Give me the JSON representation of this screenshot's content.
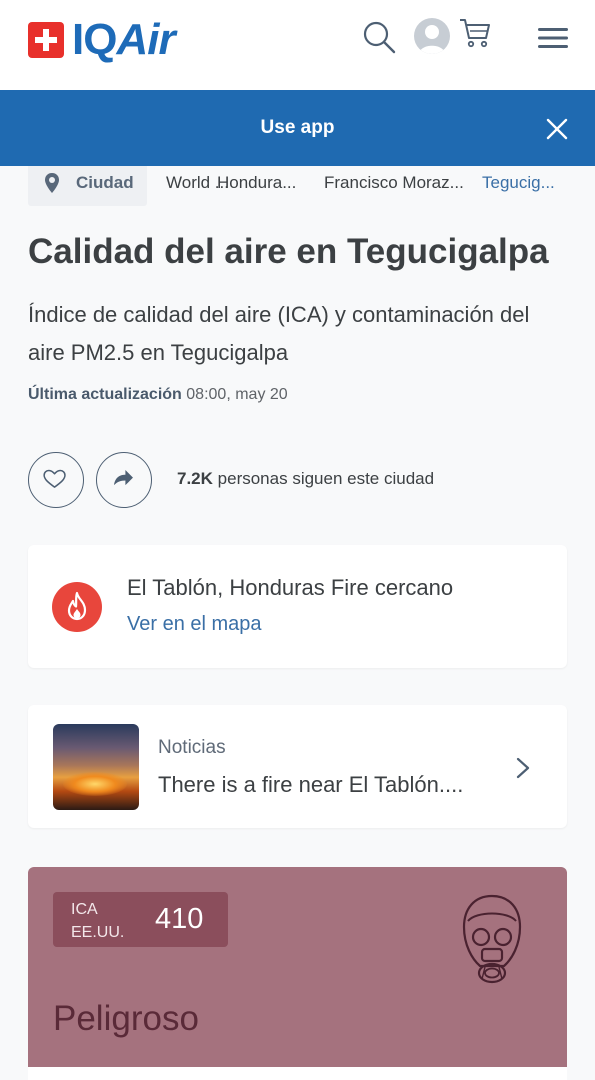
{
  "header": {
    "logo_text": "IQAir",
    "icons": [
      "search-icon",
      "avatar",
      "cart-icon",
      "menu-icon"
    ]
  },
  "app_banner": {
    "label": "Use app"
  },
  "breadcrumb": {
    "chip_label": "Ciudad",
    "items": [
      "World ...",
      "Hondura...",
      "Francisco Moraz...",
      "Tegucig..."
    ]
  },
  "page": {
    "title": "Calidad del aire en Tegucigalpa",
    "subtitle": "Índice de calidad del aire (ICA) y contaminación del aire PM2.5 en Tegucigalpa",
    "updated_label": "Última actualización",
    "updated_value": "08:00, may 20"
  },
  "follow": {
    "count": "7.2K",
    "text": "personas siguen este ciudad"
  },
  "fire_alert": {
    "title": "El Tablón, Honduras Fire cercano",
    "link": "Ver en el mapa"
  },
  "news": {
    "label": "Noticias",
    "title": "There is a fire near El Tablón...."
  },
  "aqi": {
    "label_line1": "ICA",
    "label_line2": "EE.UU.",
    "value": "410",
    "status": "Peligroso",
    "color": "#a5727e",
    "badge_color": "#8b4e5c"
  },
  "colors": {
    "brand_blue": "#1f6ab1",
    "link": "#3a6fa6",
    "fire_red": "#e8463c"
  }
}
